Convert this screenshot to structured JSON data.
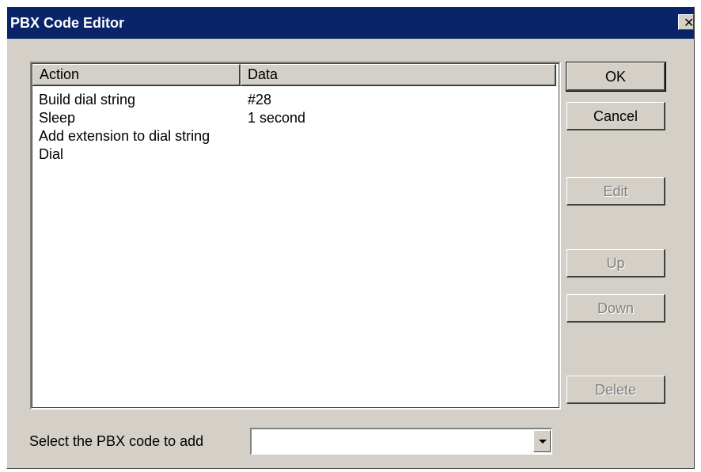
{
  "window": {
    "title": "PBX Code Editor",
    "close_glyph": "✖"
  },
  "list": {
    "columns": [
      "Action",
      "Data"
    ],
    "rows": [
      {
        "action": "Build dial string",
        "data": "#28"
      },
      {
        "action": "Sleep",
        "data": "1 second"
      },
      {
        "action": "Add extension to dial string",
        "data": ""
      },
      {
        "action": "Dial",
        "data": ""
      }
    ]
  },
  "buttons": {
    "ok": "OK",
    "cancel": "Cancel",
    "edit": "Edit",
    "up": "Up",
    "down": "Down",
    "delete": "Delete"
  },
  "pbx_select": {
    "label": "Select the PBX code to add",
    "value": ""
  },
  "colors": {
    "titlebar": "#0a246a",
    "dialog_face": "#d4d0c8",
    "disabled_text": "#808080"
  }
}
